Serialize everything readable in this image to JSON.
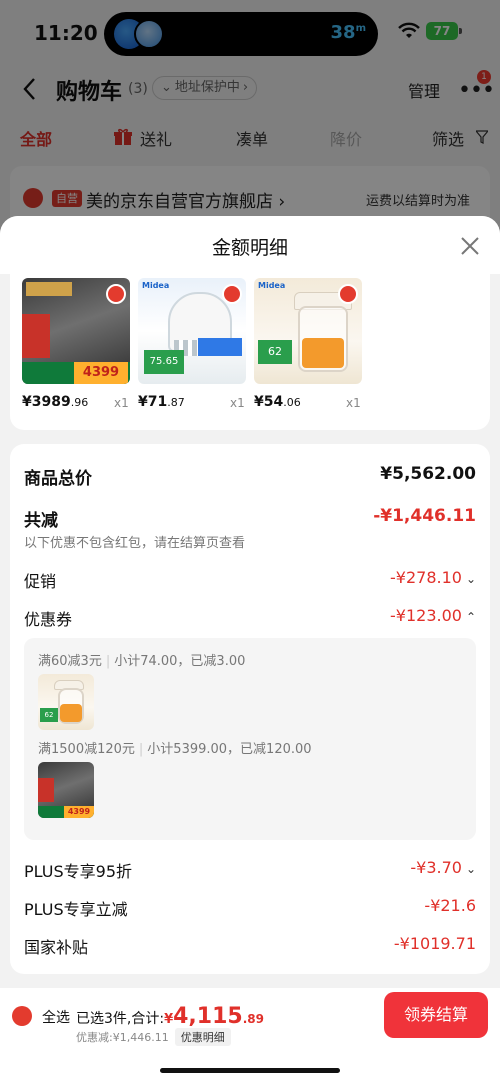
{
  "status_bar": {
    "time": "11:20",
    "island_distance": "38",
    "island_unit": "m",
    "battery": "77"
  },
  "header": {
    "title": "购物车",
    "count": "(3)",
    "address": "地址保护中",
    "manage": "管理",
    "more_badge": "1"
  },
  "filter_tabs": [
    {
      "label": "全部"
    },
    {
      "label": "送礼"
    },
    {
      "label": "凑单"
    },
    {
      "label": "降价"
    },
    {
      "label": "筛选"
    }
  ],
  "shop": {
    "badge": "自营",
    "name": "美的京东自营官方旗舰店",
    "arrow": "›",
    "shipping_note": "运费以结算时为准"
  },
  "sheet": {
    "title": "金额明细"
  },
  "products": [
    {
      "name": "dishwasher",
      "price_int": "¥3989",
      "price_dec": ".96",
      "qty": "x1",
      "thumb_price": "4399"
    },
    {
      "name": "blender",
      "price_int": "¥71",
      "price_dec": ".87",
      "qty": "x1",
      "thumb_price": "75.65"
    },
    {
      "name": "chopper",
      "price_int": "¥54",
      "price_dec": ".06",
      "qty": "x1",
      "thumb_price": "62"
    }
  ],
  "breakdown": {
    "total_label": "商品总价",
    "total_value": "¥5,562.00",
    "reduce_label": "共减",
    "reduce_value": "-¥1,446.11",
    "note": "以下优惠不包含红包，请在结算页查看",
    "promo_label": "促销",
    "promo_value": "-¥278.10",
    "coupon_label": "优惠券",
    "coupon_value": "-¥123.00",
    "coupon1_rule": "满60减3元",
    "coupon1_detail": "小计74.00，已减3.00",
    "coupon2_rule": "满1500减120元",
    "coupon2_detail": "小计5399.00，已减120.00",
    "plus95_label": "PLUS专享95折",
    "plus95_value": "-¥3.70",
    "plus_direct_label": "PLUS专享立减",
    "plus_direct_value": "-¥21.6",
    "subsidy_label": "国家补贴",
    "subsidy_value": "-¥1019.71"
  },
  "bottom_bar": {
    "select_all": "全选",
    "summary_prefix": "已选3件,合计:",
    "currency": "¥",
    "amount_int": "4,115",
    "amount_dec": ".89",
    "discount": "优惠减:¥1,446.11",
    "detail_chip": "优惠明细",
    "checkout": "领券结算"
  },
  "colors": {
    "accent": "#e0302a",
    "checkout_bg": "#f0333a",
    "check_red": "#e33b2e"
  }
}
